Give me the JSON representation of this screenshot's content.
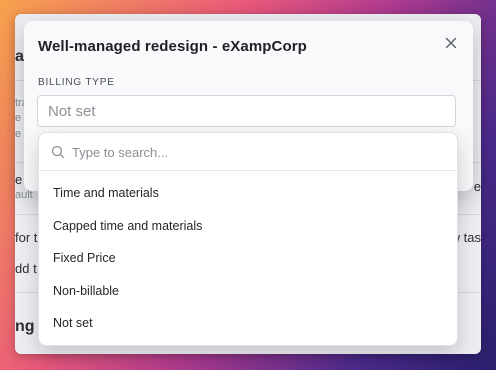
{
  "background": {
    "fragments": [
      "a",
      "tra",
      "e",
      "e",
      "ault",
      "for t",
      "dd t",
      "ng",
      "e",
      "w tas"
    ]
  },
  "modal": {
    "title": "Well-managed redesign - eXampCorp",
    "close_icon": "close-icon",
    "billing_type": {
      "label": "BILLING TYPE",
      "value": "Not set"
    }
  },
  "dropdown": {
    "search": {
      "placeholder": "Type to search...",
      "value": ""
    },
    "options": [
      "Time and materials",
      "Capped time and materials",
      "Fixed Price",
      "Non-billable",
      "Not set"
    ]
  },
  "colors": {
    "primary": "#2f5aa8",
    "modal_bg": "#f8f9fb",
    "text": "#1f2125",
    "muted": "#8d9098"
  }
}
